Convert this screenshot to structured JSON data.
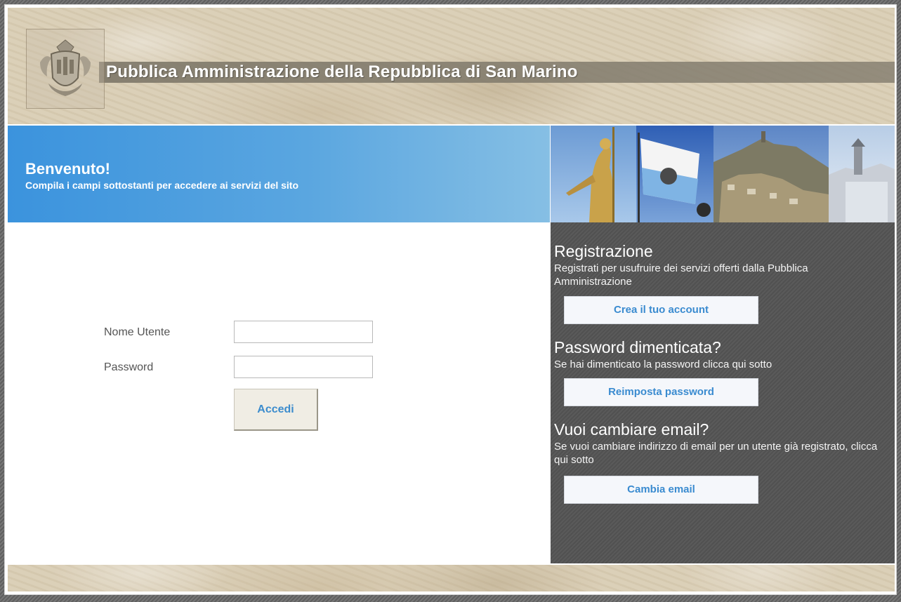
{
  "header": {
    "title": "Pubblica Amministrazione della Repubblica di San Marino",
    "emblem_icon": "coat-of-arms-icon"
  },
  "welcome": {
    "title": "Benvenuto!",
    "subtitle": "Compila i campi sottostanti per accedere ai servizi del sito"
  },
  "login": {
    "username_label": "Nome Utente",
    "username_value": "",
    "password_label": "Password",
    "password_value": "",
    "submit_label": "Accedi"
  },
  "sidebar": {
    "register": {
      "heading": "Registrazione",
      "text": "Registrati per usufruire dei servizi offerti dalla Pubblica Amministrazione",
      "button": "Crea il tuo account"
    },
    "forgot": {
      "heading": "Password dimenticata?",
      "text": "Se hai dimenticato la password clicca qui sotto",
      "button": "Reimposta password"
    },
    "email": {
      "heading": "Vuoi cambiare email?",
      "text": "Se vuoi cambiare indirizzo di email per un utente già registrato, clicca qui sotto",
      "button": "Cambia email"
    }
  },
  "colors": {
    "accent_blue": "#3b93dd",
    "link_blue": "#3a8bd0",
    "sidebar_bg": "#555555",
    "marble": "#d9cdb4"
  }
}
